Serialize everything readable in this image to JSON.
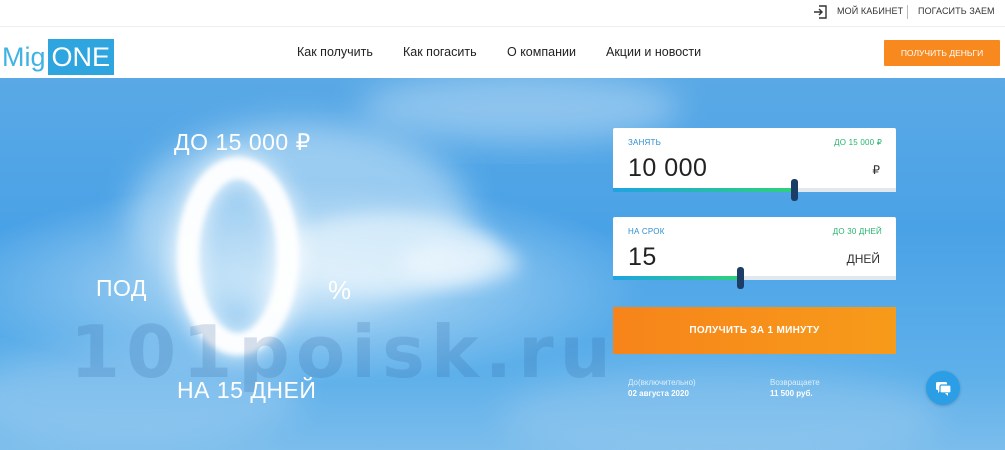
{
  "topbar": {
    "cabinet_label": "МОЙ КАБИНЕТ",
    "repay_label": "ПОГАСИТЬ ЗАЕМ"
  },
  "header": {
    "logo_part1": "Mig",
    "logo_part2": "ONE",
    "nav": [
      "Как получить",
      "Как погасить",
      "О компании",
      "Акции и новости"
    ],
    "cta_label": "ПОЛУЧИТЬ ДЕНЬГИ"
  },
  "hero": {
    "amount_line": "ДО 15 000 ₽",
    "under_label": "ПОД",
    "zero": "0",
    "percent": "%",
    "term_line": "НА 15 ДНЕЙ",
    "watermark": "101poisk.ru"
  },
  "calculator": {
    "amount": {
      "label": "ЗАНЯТЬ",
      "max_label": "ДО 15 000 ₽",
      "value": "10 000",
      "unit": "₽",
      "slider_fraction": 0.64
    },
    "term": {
      "label": "НА СРОК",
      "max_label": "ДО 30 ДНЕЙ",
      "value": "15",
      "unit": "ДНЕЙ",
      "slider_fraction": 0.45
    },
    "submit_label": "ПОЛУЧИТЬ ЗА 1 МИНУТУ",
    "until_label": "До(включительно)",
    "until_value": "02 августа 2020",
    "return_label": "Возвращаете",
    "return_value": "11 500 руб."
  },
  "colors": {
    "accent_orange": "#f7891f",
    "brand_blue": "#2ea5df",
    "slider_handle": "#1c3d66"
  },
  "icons": {
    "cabinet": "login-icon",
    "chat": "chat-icon"
  }
}
